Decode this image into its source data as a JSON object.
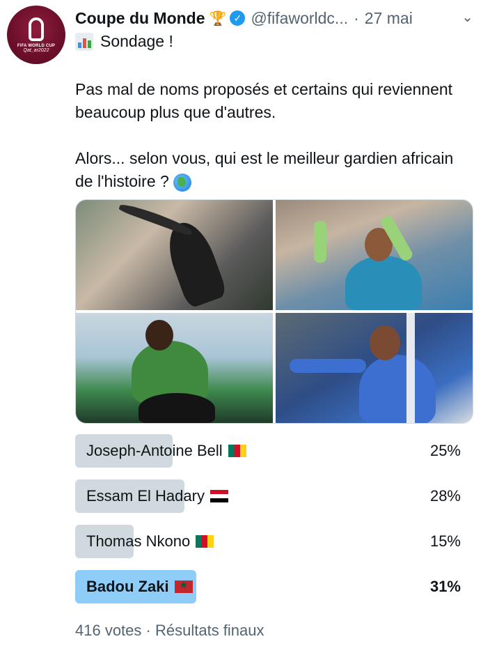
{
  "author": {
    "name": "Coupe du Monde",
    "handle": "@fifaworldc...",
    "separator": "·",
    "date": "27 mai",
    "avatar_text_line1": "FIFA WORLD CUP",
    "avatar_text_line2": "Qat_ar2022"
  },
  "poll_title": "Sondage !",
  "body": {
    "paragraph1": "Pas mal de noms proposés et certains qui reviennent beaucoup plus que d'autres.",
    "paragraph2": "Alors... selon vous, qui est le meilleur gardien africain de l'histoire ?"
  },
  "icons": {
    "trophy": "trophy-icon",
    "verified": "verified-icon",
    "chevron": "chevron-down-icon",
    "chart": "bar-chart-icon",
    "globe": "globe-africa-icon"
  },
  "poll": {
    "options": [
      {
        "label": "Joseph-Antoine Bell",
        "flag": "cameroon",
        "percent": 25,
        "percent_text": "25%",
        "winner": false
      },
      {
        "label": "Essam El Hadary",
        "flag": "egypt",
        "percent": 28,
        "percent_text": "28%",
        "winner": false
      },
      {
        "label": "Thomas Nkono",
        "flag": "cameroon",
        "percent": 15,
        "percent_text": "15%",
        "winner": false
      },
      {
        "label": "Badou Zaki",
        "flag": "morocco",
        "percent": 31,
        "percent_text": "31%",
        "winner": true
      }
    ],
    "bar_color": "#cfd9de",
    "winner_bar_color": "#8ecdf8",
    "footer_votes": "416 votes",
    "footer_sep": "·",
    "footer_status": "Résultats finaux"
  },
  "colors": {
    "verified": "#1d9bf0",
    "secondary_text": "#536471"
  }
}
